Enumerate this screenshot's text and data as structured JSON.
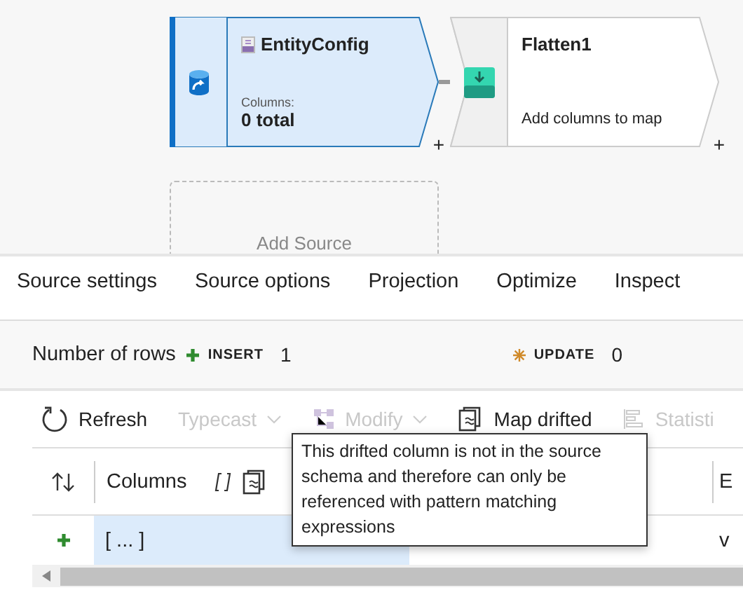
{
  "canvas": {
    "nodes": [
      {
        "kind": "source",
        "title": "EntityConfig",
        "caption": "Columns:",
        "detail": "0 total",
        "selected": true,
        "add": "+"
      },
      {
        "kind": "flatten",
        "title": "Flatten1",
        "detail": "Add columns to map",
        "selected": false,
        "add": "+"
      }
    ],
    "add_source": "Add Source"
  },
  "tabs": [
    "Source settings",
    "Source options",
    "Projection",
    "Optimize",
    "Inspect"
  ],
  "row_counts": {
    "label": "Number of rows",
    "items": [
      {
        "kind": "insert",
        "label": "INSERT",
        "value": "1"
      },
      {
        "kind": "update",
        "label": "UPDATE",
        "value": "0"
      }
    ]
  },
  "toolbar": [
    {
      "kind": "refresh",
      "label": "Refresh",
      "disabled": false,
      "dropdown": false
    },
    {
      "kind": "typecast",
      "label": "Typecast",
      "disabled": true,
      "dropdown": true
    },
    {
      "kind": "modify",
      "label": "Modify",
      "disabled": true,
      "dropdown": true
    },
    {
      "kind": "map",
      "label": "Map drifted",
      "disabled": false,
      "dropdown": false
    },
    {
      "kind": "stats",
      "label": "Statisti",
      "disabled": true,
      "dropdown": false
    }
  ],
  "table": {
    "columns": [
      {
        "label": "Columns"
      },
      {
        "label": "E"
      }
    ],
    "rows": [
      {
        "kind": "insert",
        "selected": true,
        "cells": [
          "[ ... ]",
          "v"
        ]
      }
    ]
  },
  "tooltip": "This drifted column is not in the source schema and therefore can only be referenced with pattern matching expressions"
}
